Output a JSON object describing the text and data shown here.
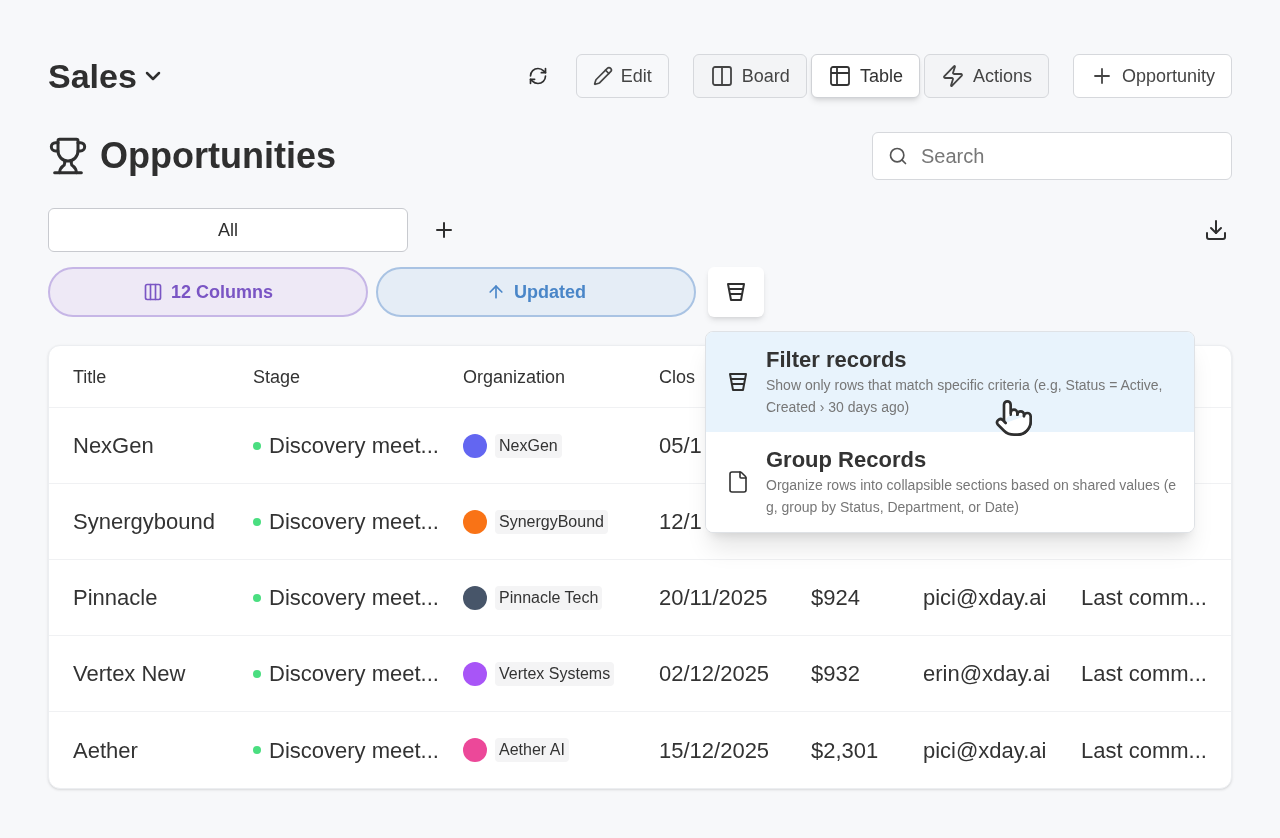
{
  "header": {
    "title": "Sales",
    "actions": [
      {
        "kind": "refresh"
      },
      {
        "kind": "edit",
        "label": "Edit"
      }
    ],
    "views": [
      {
        "kind": "board",
        "label": "Board",
        "selected": false
      },
      {
        "kind": "table",
        "label": "Table",
        "selected": true
      },
      {
        "kind": "actions",
        "label": "Actions",
        "selected": false
      }
    ],
    "create_button": "Opportunity"
  },
  "page": {
    "title": "Opportunities",
    "search": {
      "placeholder": "Search"
    }
  },
  "view_tabs": [
    {
      "label": "All",
      "selected": true
    }
  ],
  "toolbar": {
    "columns": "12 Columns",
    "sort": "Updated"
  },
  "menu": {
    "items": [
      {
        "kind": "filter",
        "title": "Filter records",
        "description": "Show only rows that match specific criteria (e.g, Status = Active, Created › 30 days ago)",
        "selected": true
      },
      {
        "kind": "group",
        "title": "Group Records",
        "description": "Organize rows into collapsible sections based on shared values (e g, group by Status, Department, or Date)",
        "selected": false
      }
    ]
  },
  "table": {
    "columns": [
      "Title",
      "Stage",
      "Organization",
      "Clos"
    ],
    "rows": [
      {
        "title": "NexGen",
        "stage": "Discovery meet...",
        "org": "NexGen",
        "color": "#6366f1",
        "close": "05/1"
      },
      {
        "title": "Synergybound",
        "stage": "Discovery meet...",
        "org": "SynergyBound",
        "color": "#f97316",
        "close": "12/1"
      },
      {
        "title": "Pinnacle",
        "stage": "Discovery meet...",
        "org": "Pinnacle Tech",
        "color": "#475569",
        "close": "20/11/2025",
        "amount": "$924",
        "email": "pici@xday.ai",
        "note": "Last comm..."
      },
      {
        "title": "Vertex New",
        "stage": "Discovery meet...",
        "org": "Vertex Systems",
        "color": "#a855f7",
        "close": "02/12/2025",
        "amount": "$932",
        "email": "erin@xday.ai",
        "note": "Last comm..."
      },
      {
        "title": "Aether",
        "stage": "Discovery meet...",
        "org": "Aether AI",
        "color": "#ec4899",
        "close": "15/12/2025",
        "amount": "$2,301",
        "email": "pici@xday.ai",
        "note": "Last comm..."
      }
    ]
  }
}
